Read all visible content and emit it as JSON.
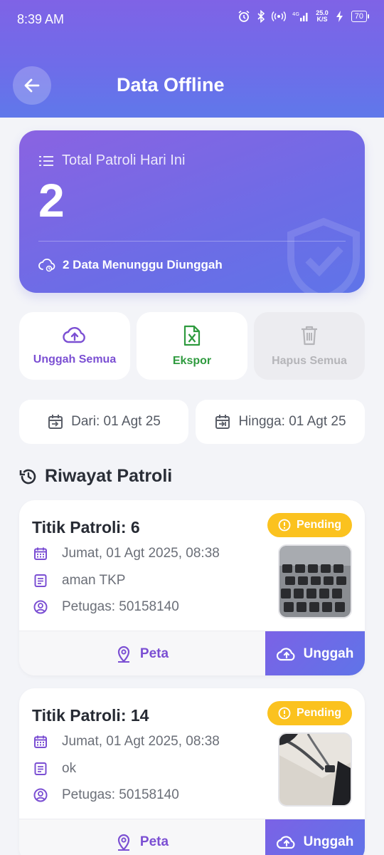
{
  "status_bar": {
    "time": "8:39 AM",
    "net_speed_value": "25.0",
    "net_speed_unit": "K/S",
    "battery": "70"
  },
  "header": {
    "title": "Data Offline"
  },
  "summary": {
    "label": "Total Patroli Hari Ini",
    "count": "2",
    "pending_text": "2 Data Menunggu Diunggah"
  },
  "actions": {
    "upload_all": "Unggah Semua",
    "export": "Ekspor",
    "delete_all": "Hapus Semua"
  },
  "date_range": {
    "from": "Dari: 01 Agt 25",
    "to": "Hingga: 01 Agt 25"
  },
  "section": {
    "title": "Riwayat Patroli"
  },
  "records": [
    {
      "title": "Titik Patroli: 6",
      "status": "Pending",
      "datetime": "Jumat, 01 Agt 2025, 08:38",
      "note": "aman TKP",
      "officer": "Petugas: 50158140",
      "map_label": "Peta",
      "upload_label": "Unggah"
    },
    {
      "title": "Titik Patroli: 14",
      "status": "Pending",
      "datetime": "Jumat, 01 Agt 2025, 08:38",
      "note": "ok",
      "officer": "Petugas: 50158140",
      "map_label": "Peta",
      "upload_label": "Unggah"
    }
  ],
  "colors": {
    "primary": "#7b4fd3",
    "export_green": "#2e9a3e",
    "pending_badge": "#fbc21f",
    "disabled": "#b5b5b9"
  }
}
